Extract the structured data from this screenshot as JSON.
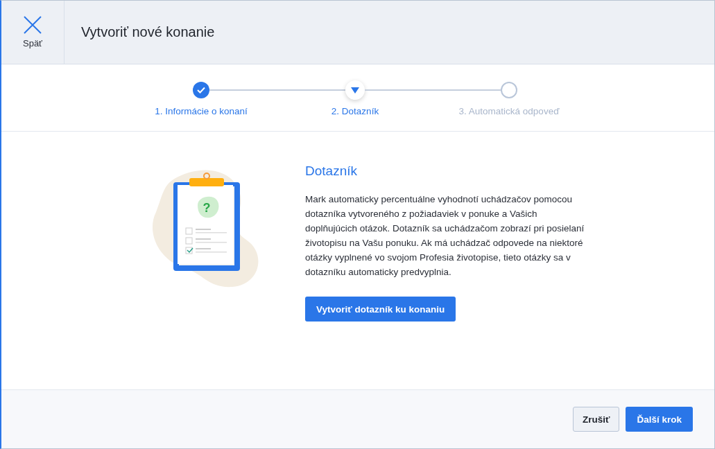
{
  "header": {
    "close_label": "Späť",
    "title": "Vytvoriť nové konanie"
  },
  "steps": [
    {
      "label": "1. Informácie o konaní",
      "kind": "done"
    },
    {
      "label": "2. Dotazník",
      "kind": "current"
    },
    {
      "label": "3. Automatická odpoveď",
      "kind": "todo"
    }
  ],
  "content": {
    "illustration_mark": "?",
    "heading": "Dotazník",
    "text": "Mark automaticky percentuálne vyhodnotí uchádzačov pomocou dotazníka vytvoreného z požiadaviek v ponuke a Vašich doplňujúcich otázok. Dotazník sa uchádzačom zobrazí pri posielaní životopisu na Vašu ponuku. Ak má uchádzač odpovede na niektoré otázky vyplnené vo svojom Profesia životopise, tieto otázky sa v dotazníku automaticky predvyplnia.",
    "button": "Vytvoriť dotazník ku konaniu"
  },
  "footer": {
    "cancel": "Zrušiť",
    "next": "Ďalší krok"
  }
}
